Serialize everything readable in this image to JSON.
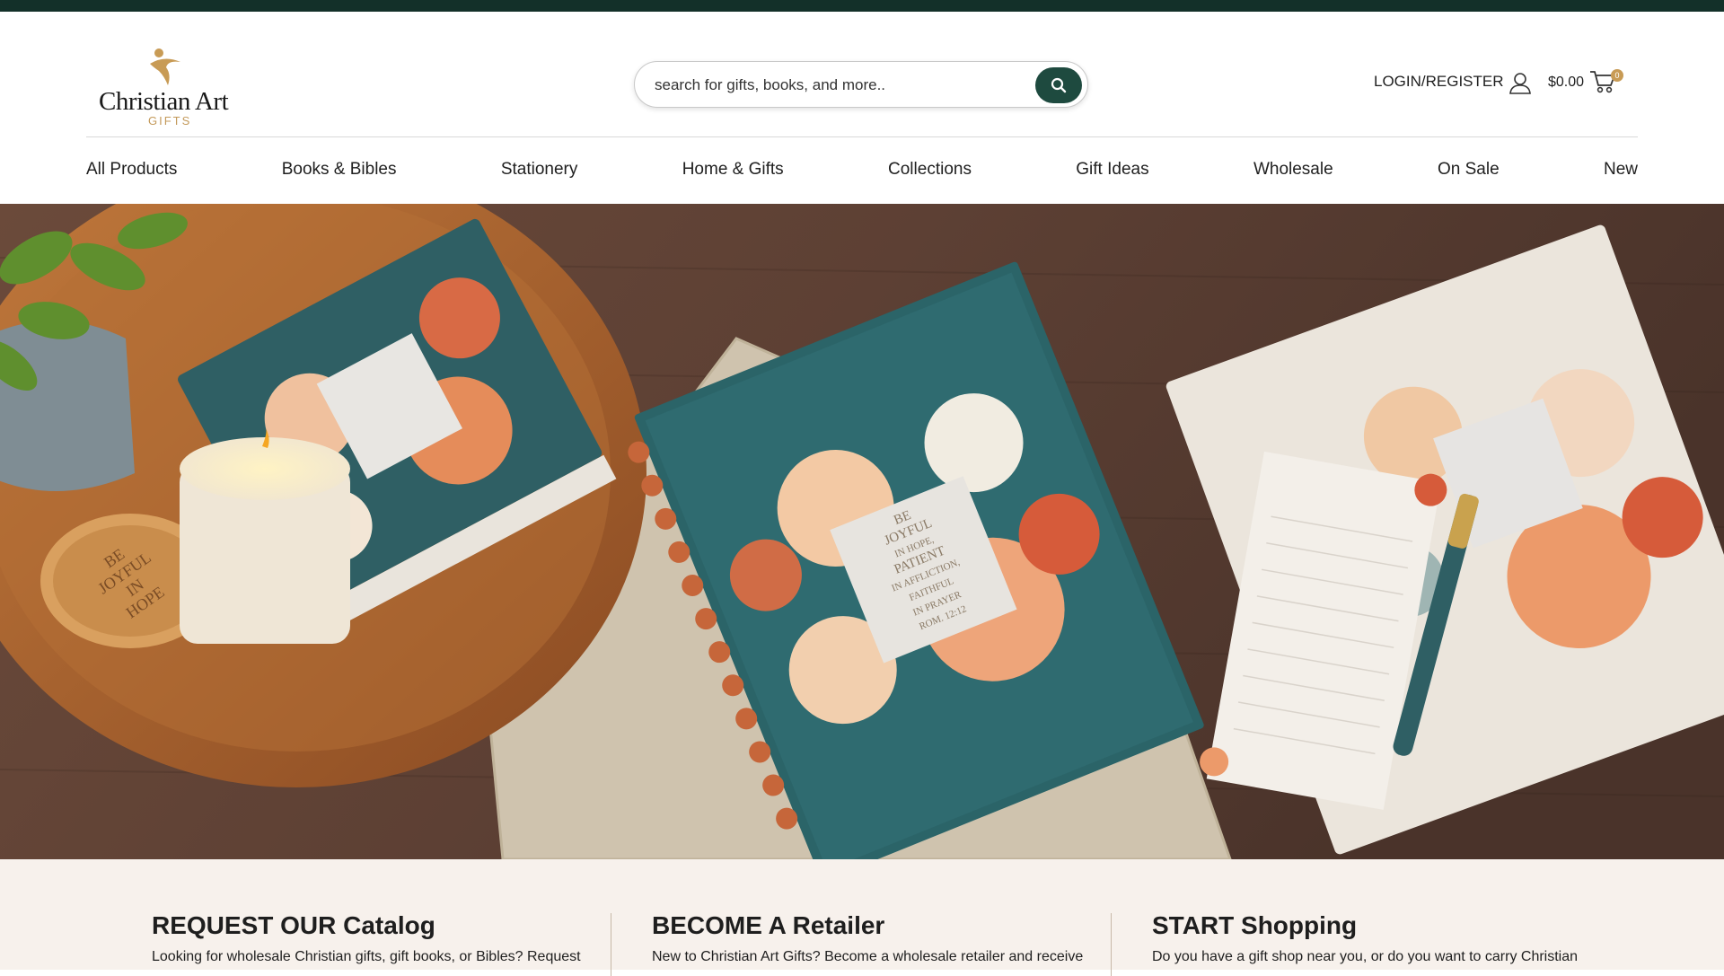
{
  "brand": {
    "logo_text": "Christian Art",
    "logo_sub": "GIFTS"
  },
  "search": {
    "placeholder": "search for gifts, books, and more.."
  },
  "account": {
    "label": "LOGIN/REGISTER"
  },
  "cart": {
    "total": "$0.00",
    "count": "0"
  },
  "nav": {
    "items": [
      "All Products",
      "Books & Bibles",
      "Stationery",
      "Home & Gifts",
      "Collections",
      "Gift Ideas",
      "Wholesale",
      "On Sale",
      "New"
    ]
  },
  "hero": {
    "journal_text": [
      "BE",
      "JOYFUL",
      "IN HOPE,",
      "PATIENT",
      "IN AFFLICTION,",
      "FAITHFUL",
      "IN PRAYER",
      "ROM. 12:12"
    ],
    "lid_text": [
      "BE",
      "JOYFUL",
      "IN",
      "HOPE"
    ]
  },
  "info": [
    {
      "title": "REQUEST OUR Catalog",
      "text": "Looking for wholesale Christian gifts, gift books, or Bibles? Request"
    },
    {
      "title": "BECOME A Retailer",
      "text": "New to Christian Art Gifts? Become a wholesale retailer and receive"
    },
    {
      "title": "START Shopping",
      "text": "Do you have a gift shop near you, or do you want to carry Christian"
    }
  ],
  "colors": {
    "topbar": "#133029",
    "accent": "#1e4a3f",
    "gold": "#c89b55",
    "footer_bg": "#f7f1ec"
  }
}
